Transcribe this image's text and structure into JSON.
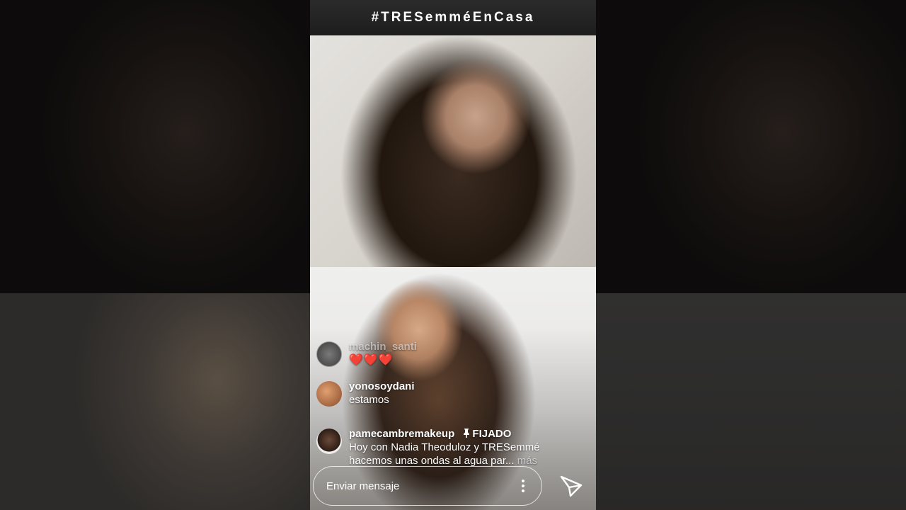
{
  "banner": {
    "hashtag": "#TRESemméEnCasa"
  },
  "comments": [
    {
      "username": "machin_santi",
      "text": "❤️❤️❤️",
      "avatar_icon": "profile-avatar"
    },
    {
      "username": "yonosoydani",
      "text": "estamos",
      "avatar_icon": "profile-avatar"
    },
    {
      "username": "pamecambremakeup",
      "pinned_label": "FIJADO",
      "pinned_icon": "pin-icon",
      "text_line1": "Hoy con Nadia Theoduloz y TRESemmé",
      "text_line2": "hacemos unas ondas al agua par...",
      "more": "más",
      "avatar_icon": "profile-avatar"
    }
  ],
  "message_bar": {
    "placeholder": "Enviar mensaje",
    "options_icon": "more-vertical-icon",
    "send_icon": "send-icon"
  },
  "colors": {
    "heart": "#e0202a",
    "text": "#ffffff"
  }
}
